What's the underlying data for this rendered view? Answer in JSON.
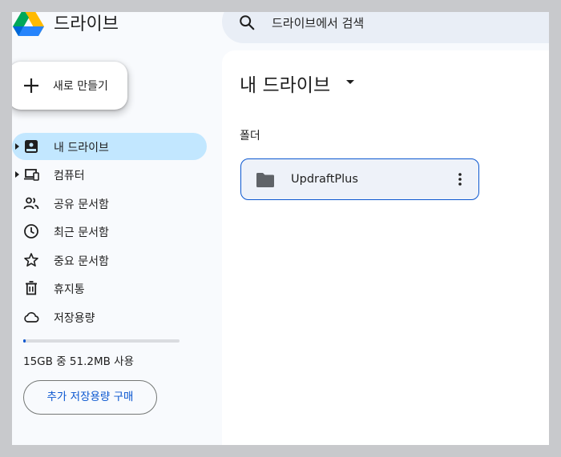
{
  "app": {
    "title": "드라이브"
  },
  "search": {
    "placeholder": "드라이브에서 검색"
  },
  "new_button": {
    "label": "새로 만들기"
  },
  "sidebar": {
    "items": [
      {
        "label": "내 드라이브",
        "icon": "my-drive-icon",
        "active": true,
        "expandable": true
      },
      {
        "label": "컴퓨터",
        "icon": "computers-icon",
        "active": false,
        "expandable": true
      },
      {
        "label": "공유 문서함",
        "icon": "shared-people-icon",
        "active": false,
        "expandable": false
      },
      {
        "label": "최근 문서함",
        "icon": "clock-icon",
        "active": false,
        "expandable": false
      },
      {
        "label": "중요 문서함",
        "icon": "star-icon",
        "active": false,
        "expandable": false
      },
      {
        "label": "휴지통",
        "icon": "trash-icon",
        "active": false,
        "expandable": false
      },
      {
        "label": "저장용량",
        "icon": "cloud-icon",
        "active": false,
        "expandable": false
      }
    ]
  },
  "storage": {
    "usage_text": "15GB 중 51.2MB 사용",
    "used_fraction": 0.003,
    "buy_label": "추가 저장용량 구매"
  },
  "main": {
    "title": "내 드라이브",
    "section_label": "폴더",
    "folders": [
      {
        "name": "UpdraftPlus",
        "icon": "folder-icon"
      }
    ]
  },
  "colors": {
    "accent": "#0b57d0",
    "active_nav": "#c2e7ff",
    "search_bg": "#e9eef6",
    "app_bg": "#f8fafd"
  }
}
